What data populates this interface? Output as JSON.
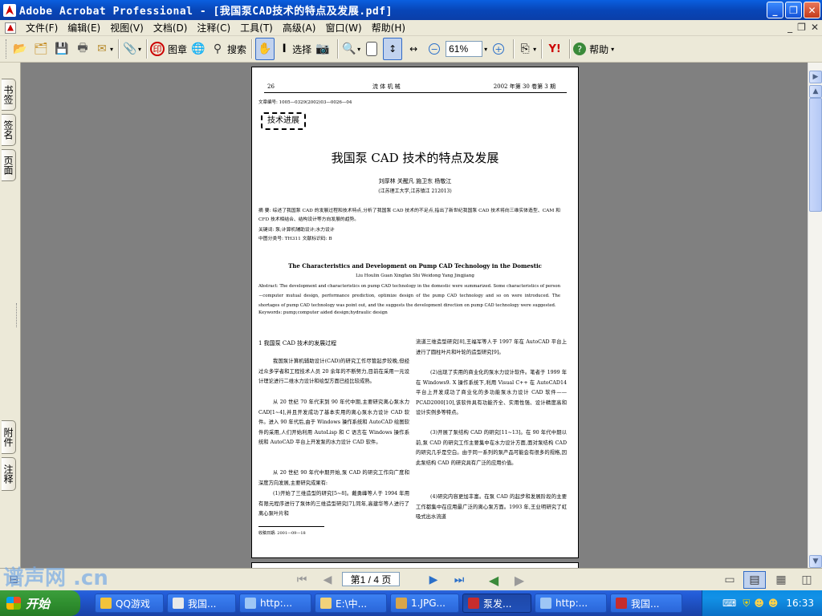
{
  "window": {
    "title": "Adobe Acrobat Professional - [我国泵CAD技术的特点及发展.pdf]"
  },
  "menu": [
    "文件(F)",
    "编辑(E)",
    "视图(V)",
    "文档(D)",
    "注释(C)",
    "工具(T)",
    "高级(A)",
    "窗口(W)",
    "帮助(H)"
  ],
  "toolbar": {
    "stamp_label": "图章",
    "search_label": "搜索",
    "select_label": "选择",
    "zoom_value": "61%",
    "help_label": "帮助",
    "yahoo_label": "Y!"
  },
  "leftpane": {
    "tabs": [
      "书签",
      "签名",
      "页面",
      "附件",
      "注释"
    ]
  },
  "page": {
    "header_num": "26",
    "header_journal": "流 体 机 械",
    "header_issue": "2002 年第 30 卷第 3 期",
    "article_no": "文章编号: 1005—0329(2002)03—0026—04",
    "section_tag": "技术进展",
    "title": "我国泵 CAD 技术的特点及发展",
    "authors": "刘厚林  关醒凡  施卫东  杨敬江",
    "affiliation": "(江苏理工大学,江苏镇江 212013)",
    "abstract_cn": "摘  要: 综述了我国泵 CAD 的发展过程和技术特点,分析了我国泵 CAD 技术的不足点,指出了新世纪我国泵 CAD 技术将向三维实体造型、CAM 和 CFD 技术相结合、结构设计等方向发展的趋势。",
    "keywords_cn": "关键词: 泵;计算机辅助设计;水力设计",
    "classification": "中图分类号: TH311          文献标识码: B",
    "title_en": "The Characteristics and Development on Pump CAD Technology in the Domestic",
    "authors_en": "Liu Houlin  Guan Xingfan  Shi Weidong  Yang Jingjiang",
    "abstract_en": "Abstract: The development and characteristics on pump CAD technology in the domestic were summarized. Some characteristics of person－computer mutual design, performance prediction, optimize design of the pump CAD technology and so on were introduced. The shortages of pump CAD technology was point out, and the suggests the development direction on pump CAD technology were suggested.",
    "keywords_en": "Keywords: pump;computer aided design;hydraulic design",
    "col1_heading": "1  我国泵 CAD 技术的发展过程",
    "col1_p1": "我国泵计算机辅助设计(CAD)的研究工作尽管起步较晚,但经过众多学者和工程技术人员 20 余年的不断努力,目前在采用一元设计理论进行二维水力设计和绘型方面已经比较成熟。",
    "col1_p2": "从 20 世纪 70 年代末到 90 年代中期,主要研究离心泵水力 CAD[1~4],并且开发成功了基本实用的离心泵水力设计 CAD 软件。进入 90 年代后,由于 Windows 操作系统和 AutoCAD 绘图软件的采用,人们开始利用 AutoLisp 和 C 语言在 Windows 操作系统和 AutoCAD 平台上开发泵的水力设计 CAD 软件。",
    "col1_p3": "从 20 世纪 90 年代中期开始,泵 CAD 的研究工作向广度和深度方向发展,主要研究成果有:",
    "col1_p4": "(1)开始了三维造型的研究[5~8]。戴勇峰等人于 1994 年用有限元程序进行了泵体的三维造型研究[7],同年,高建华等人进行了离心泵叶片和",
    "received": "收稿日期: 2001—09—18",
    "col2_p1": "流道三维造型研究[8],王福军等人于 1997 年在 AutoCAD 平台上进行了圆柱叶片和叶轮的造型研究[9]。",
    "col2_p2": "(2)出现了实用的商业化的泵水力设计软件。笔者于 1999 年在 Windows9. X 操作系统下,利用 Visual C++ 在 AutoCAD14 平台上开发成功了商业化的多功能泵水力设计 CAD 软件——PCAD2000[10],该软件具有功能齐全、实用性强、设计精度高和设计实例多等特点。",
    "col2_p3": "(3)开展了泵结构 CAD 的研究[11~13]。在 90 年代中期以前,泵 CAD 的研究工作主要集中在水力设计方面,面对泵结构 CAD 的研究几乎是空白。由于同一系列的泵产品可能会有很多的规格,因此泵结构 CAD 的研究具有广泛的应用价值。",
    "col2_p4": "(4)研究内容更加丰富。在泵 CAD 的起步和发展阶段的主要工作都集中在应用最广泛的离心泵方面。1993 年,王业明研究了虹吸式出水流道"
  },
  "statusbar": {
    "page_indicator": "第1 / 4 页"
  },
  "taskbar": {
    "start": "开始",
    "items": [
      "QQ游戏",
      "我国...",
      "http:...",
      "E:\\中...",
      "1.JPG...",
      "泵发...",
      "http:...",
      "我国..."
    ],
    "clock": "16:33"
  },
  "watermark": "谱声网 .cn"
}
